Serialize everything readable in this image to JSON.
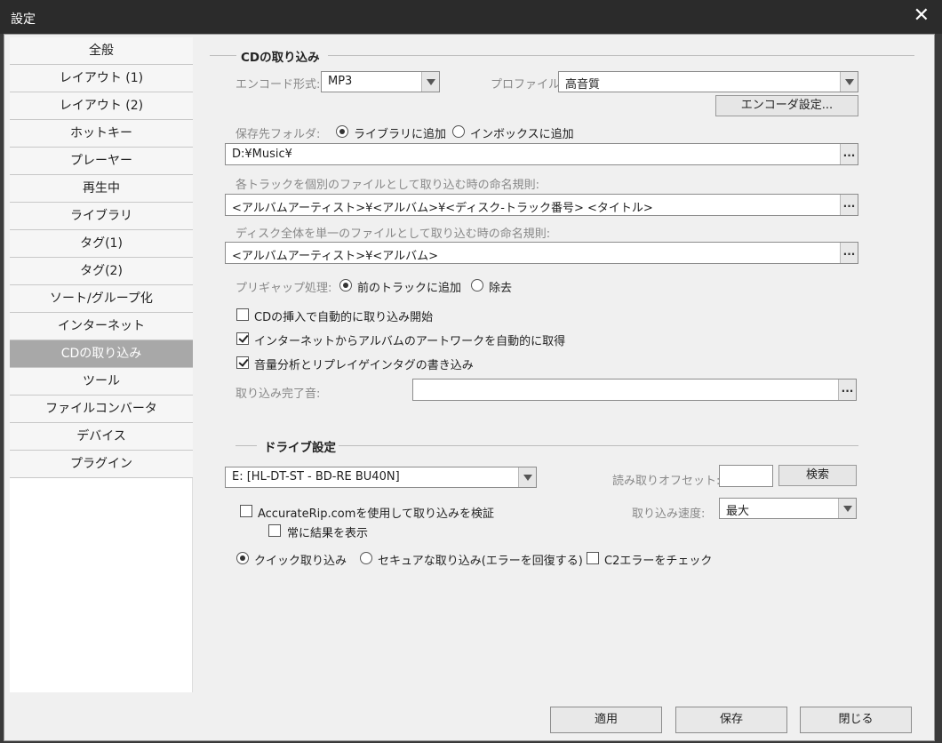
{
  "window": {
    "title": "設定"
  },
  "sidebar": {
    "items": [
      {
        "label": "全般"
      },
      {
        "label": "レイアウト (1)"
      },
      {
        "label": "レイアウト (2)"
      },
      {
        "label": "ホットキー"
      },
      {
        "label": "プレーヤー"
      },
      {
        "label": "再生中"
      },
      {
        "label": "ライブラリ"
      },
      {
        "label": "タグ(1)"
      },
      {
        "label": "タグ(2)"
      },
      {
        "label": "ソート/グループ化"
      },
      {
        "label": "インターネット"
      },
      {
        "label": "CDの取り込み"
      },
      {
        "label": "ツール"
      },
      {
        "label": "ファイルコンバータ"
      },
      {
        "label": "デバイス"
      },
      {
        "label": "プラグイン"
      }
    ],
    "active": "CDの取り込み"
  },
  "rip": {
    "group_title": "CDの取り込み",
    "encode_label": "エンコード形式:",
    "encode_value": "MP3",
    "profile_label": "プロファイル:",
    "profile_value": "高音質",
    "encoder_settings_button": "エンコーダ設定...",
    "save_folder_label": "保存先フォルダ:",
    "radio_library": "ライブラリに追加",
    "radio_inbox": "インボックスに追加",
    "save_folder_value": "D:¥Music¥",
    "track_naming_label": "各トラックを個別のファイルとして取り込む時の命名規則:",
    "track_naming_value": "<アルバムアーティスト>¥<アルバム>¥<ディスク-トラック番号> <タイトル>",
    "disc_naming_label": "ディスク全体を単一のファイルとして取り込む時の命名規則:",
    "disc_naming_value": "<アルバムアーティスト>¥<アルバム>",
    "pregap_label": "プリギャップ処理:",
    "pregap_prev": "前のトラックに追加",
    "pregap_remove": "除去",
    "auto_start_label": "CDの挿入で自動的に取り込み開始",
    "artwork_label": "インターネットからアルバムのアートワークを自動的に取得",
    "replaygain_label": "音量分析とリプレイゲインタグの書き込み",
    "complete_sound_label": "取り込み完了音:",
    "complete_sound_value": "",
    "browse": "..."
  },
  "drive": {
    "group_title": "ドライブ設定",
    "drive_value": "E: [HL-DT-ST - BD-RE BU40N]",
    "offset_label": "読み取りオフセット:",
    "offset_value": "",
    "search_button": "検索",
    "accuraterip_label": "AccurateRip.comを使用して取り込みを検証",
    "always_show_label": "常に結果を表示",
    "speed_label": "取り込み速度:",
    "speed_value": "最大",
    "mode_quick": "クイック取り込み",
    "mode_secure": "セキュアな取り込み(エラーを回復する)",
    "c2_label": "C2エラーをチェック"
  },
  "footer": {
    "apply": "適用",
    "save": "保存",
    "close": "閉じる"
  }
}
